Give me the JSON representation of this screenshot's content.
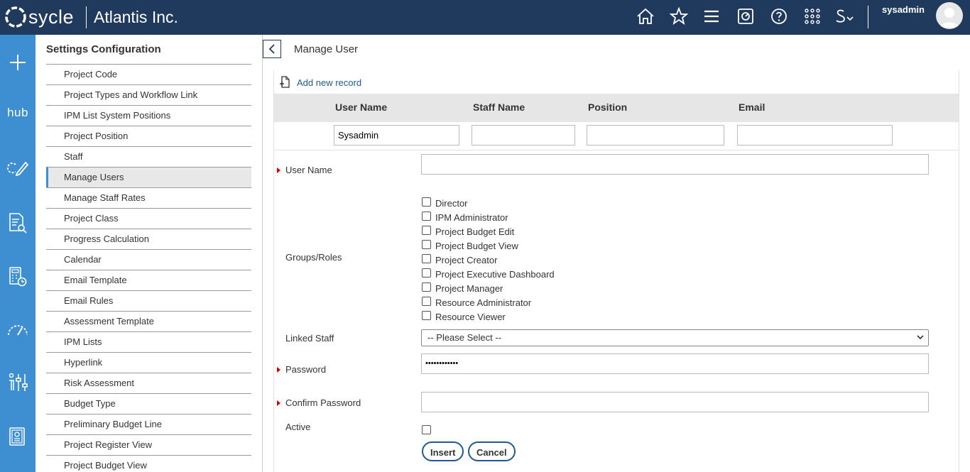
{
  "header": {
    "logo_text": "sycle",
    "company": "Atlantis Inc.",
    "username": "sysadmin",
    "icons": [
      "home-icon",
      "star-icon",
      "menu-icon",
      "report-icon",
      "help-icon",
      "apps-grid-icon",
      "s-dropdown-icon"
    ]
  },
  "rail": {
    "hub_label": "hub",
    "items": [
      "plus-icon",
      "hub-icon",
      "sync-edit-icon",
      "search-document-icon",
      "calculator-clock-icon",
      "gauge-icon",
      "resource-sliders-icon",
      "report-book-icon"
    ]
  },
  "settings": {
    "title": "Settings Configuration",
    "items": [
      {
        "label": "Project Code"
      },
      {
        "label": "Project Types and Workflow Link"
      },
      {
        "label": "IPM List System Positions"
      },
      {
        "label": "Project Position"
      },
      {
        "label": "Staff"
      },
      {
        "label": "Manage Users",
        "active": true
      },
      {
        "label": "Manage Staff Rates"
      },
      {
        "label": "Project Class"
      },
      {
        "label": "Progress Calculation"
      },
      {
        "label": "Calendar"
      },
      {
        "label": "Email Template"
      },
      {
        "label": "Email Rules"
      },
      {
        "label": "Assessment Template"
      },
      {
        "label": "IPM Lists"
      },
      {
        "label": "Hyperlink"
      },
      {
        "label": "Risk Assessment"
      },
      {
        "label": "Budget Type"
      },
      {
        "label": "Preliminary Budget Line"
      },
      {
        "label": "Project Register View"
      },
      {
        "label": "Project Budget View"
      }
    ]
  },
  "main": {
    "title": "Manage User",
    "add_record": "Add new record",
    "grid": {
      "columns": [
        "User Name",
        "Staff Name",
        "Position",
        "Email"
      ],
      "filters": [
        "Sysadmin",
        "",
        "",
        ""
      ]
    },
    "form": {
      "user_name_label": "User Name",
      "user_name_value": "",
      "groups_label": "Groups/Roles",
      "roles": [
        {
          "label": "Director",
          "checked": false
        },
        {
          "label": "IPM Administrator",
          "checked": false
        },
        {
          "label": "Project Budget Edit",
          "checked": false
        },
        {
          "label": "Project Budget View",
          "checked": false
        },
        {
          "label": "Project Creator",
          "checked": false
        },
        {
          "label": "Project Executive Dashboard",
          "checked": false
        },
        {
          "label": "Project Manager",
          "checked": false
        },
        {
          "label": "Resource Administrator",
          "checked": false
        },
        {
          "label": "Resource Viewer",
          "checked": false
        }
      ],
      "linked_staff_label": "Linked Staff",
      "linked_staff_value": "-- Please Select --",
      "password_label": "Password",
      "password_value": "••••••••••••",
      "confirm_password_label": "Confirm Password",
      "confirm_password_value": "",
      "active_label": "Active",
      "active_checked": false,
      "insert_label": "Insert",
      "cancel_label": "Cancel"
    }
  },
  "colors": {
    "topbar": "#1f3a5c",
    "rail": "#3d8fd1",
    "link": "#1f5a96",
    "required": "#cc0000"
  }
}
